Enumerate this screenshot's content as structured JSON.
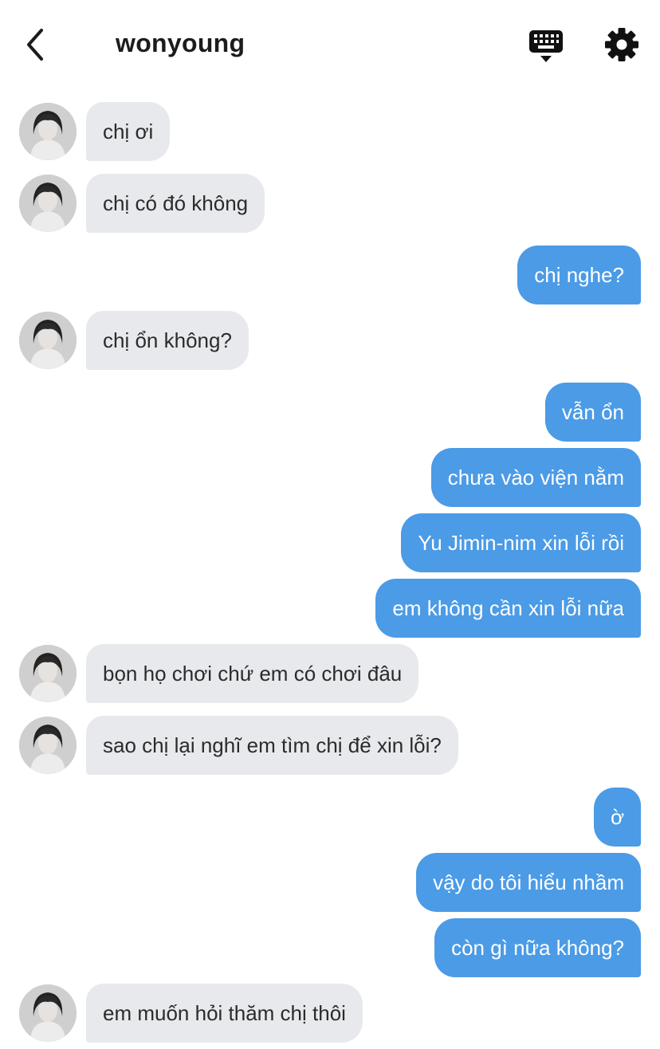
{
  "header": {
    "title": "wonyoung",
    "back_icon": "chevron-left-icon",
    "keyboard_icon": "keyboard-icon",
    "settings_icon": "gear-icon"
  },
  "colors": {
    "sent_bubble": "#4b9be6",
    "received_bubble": "#e8e9ed",
    "background": "#ffffff"
  },
  "messages": [
    {
      "from": "them",
      "text": "chị ơi"
    },
    {
      "from": "them",
      "text": "chị có đó không"
    },
    {
      "from": "me",
      "text": "chị nghe?"
    },
    {
      "from": "them",
      "text": "chị ổn không?"
    },
    {
      "from": "me",
      "text": "vẫn ổn"
    },
    {
      "from": "me",
      "text": "chưa vào viện nằm"
    },
    {
      "from": "me",
      "text": "Yu Jimin-nim xin lỗi rồi"
    },
    {
      "from": "me",
      "text": "em không cần xin lỗi nữa"
    },
    {
      "from": "them",
      "text": "bọn họ chơi chứ em có chơi đâu"
    },
    {
      "from": "them",
      "text": "sao chị lại nghĩ em tìm chị để xin lỗi?"
    },
    {
      "from": "me",
      "text": "ờ"
    },
    {
      "from": "me",
      "text": "vậy do tôi hiểu nhầm"
    },
    {
      "from": "me",
      "text": "còn gì nữa không?"
    },
    {
      "from": "them",
      "text": "em muốn hỏi thăm chị thôi"
    }
  ]
}
